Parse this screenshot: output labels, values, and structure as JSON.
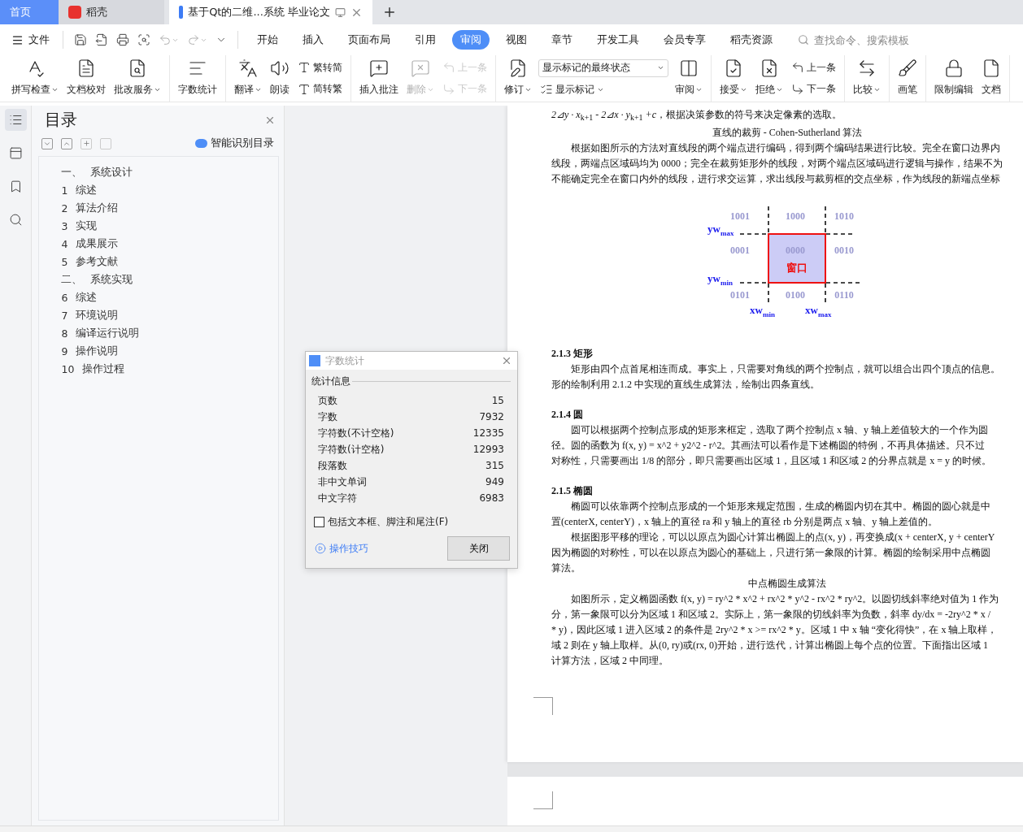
{
  "app_tabs": [
    {
      "kind": "home",
      "label": "首页",
      "selected": false
    },
    {
      "kind": "brand",
      "label": "稻壳",
      "selected": false
    },
    {
      "kind": "document",
      "label": "基于Qt的二维...系统 毕业论文",
      "selected": true
    }
  ],
  "menu": {
    "file_label": "文件",
    "tabs": [
      {
        "label": "开始",
        "selected": false
      },
      {
        "label": "插入",
        "selected": false
      },
      {
        "label": "页面布局",
        "selected": false
      },
      {
        "label": "引用",
        "selected": false
      },
      {
        "label": "审阅",
        "selected": true
      },
      {
        "label": "视图",
        "selected": false
      },
      {
        "label": "章节",
        "selected": false
      },
      {
        "label": "开发工具",
        "selected": false
      },
      {
        "label": "会员专享",
        "selected": false
      },
      {
        "label": "稻壳资源",
        "selected": false
      }
    ],
    "search": {
      "placeholder": "查找命令、搜索模板"
    }
  },
  "ribbon": [
    {
      "items": [
        {
          "kind": "large",
          "label": "拼写检查",
          "dropdown": true,
          "disabled": false
        },
        {
          "kind": "large",
          "label": "文档校对",
          "dropdown": false,
          "disabled": false
        },
        {
          "kind": "large",
          "label": "批改服务",
          "dropdown": true,
          "disabled": false
        }
      ]
    },
    {
      "items": [
        {
          "kind": "large",
          "label": "字数统计",
          "dropdown": false,
          "disabled": false
        }
      ]
    },
    {
      "items": [
        {
          "kind": "large",
          "label": "翻译",
          "dropdown": true,
          "disabled": false
        },
        {
          "kind": "large",
          "label": "朗读",
          "dropdown": false,
          "disabled": false
        },
        {
          "kind": "stack",
          "items": [
            {
              "kind": "small",
              "label": "繁转简",
              "dropdown": false,
              "disabled": false
            },
            {
              "kind": "small",
              "label": "简转繁",
              "dropdown": false,
              "disabled": false
            }
          ]
        }
      ]
    },
    {
      "items": [
        {
          "kind": "large",
          "label": "插入批注",
          "dropdown": false,
          "disabled": false
        },
        {
          "kind": "large",
          "label": "删除",
          "dropdown": true,
          "disabled": true
        },
        {
          "kind": "stack",
          "items": [
            {
              "kind": "small",
              "label": "上一条",
              "dropdown": false,
              "disabled": true
            },
            {
              "kind": "small",
              "label": "下一条",
              "dropdown": false,
              "disabled": true
            }
          ]
        }
      ]
    },
    {
      "items": [
        {
          "kind": "large",
          "label": "修订",
          "dropdown": true,
          "disabled": false
        },
        {
          "kind": "stack",
          "items": [
            {
              "kind": "select",
              "label": "显示标记的最终状态",
              "dropdown": true,
              "disabled": false
            },
            {
              "kind": "small",
              "label": "显示标记",
              "dropdown": true,
              "disabled": false
            }
          ]
        },
        {
          "kind": "large",
          "label": "审阅",
          "dropdown": true,
          "disabled": false
        }
      ]
    },
    {
      "items": [
        {
          "kind": "large",
          "label": "接受",
          "dropdown": true,
          "disabled": false
        },
        {
          "kind": "large",
          "label": "拒绝",
          "dropdown": true,
          "disabled": false
        },
        {
          "kind": "stack",
          "items": [
            {
              "kind": "small",
              "label": "上一条",
              "dropdown": false,
              "disabled": false
            },
            {
              "kind": "small",
              "label": "下一条",
              "dropdown": false,
              "disabled": false
            }
          ]
        }
      ]
    },
    {
      "items": [
        {
          "kind": "large",
          "label": "比较",
          "dropdown": true,
          "disabled": false
        }
      ]
    },
    {
      "items": [
        {
          "kind": "large",
          "label": "画笔",
          "dropdown": false,
          "disabled": false
        }
      ]
    },
    {
      "items": [
        {
          "kind": "large",
          "label": "限制编辑",
          "dropdown": false,
          "disabled": false
        },
        {
          "kind": "large",
          "label": "文档",
          "dropdown": false,
          "disabled": false
        }
      ]
    }
  ],
  "toc": {
    "title": "目录",
    "smart_label": "智能识别目录",
    "items": [
      {
        "number": "一、",
        "title": "系统设计"
      },
      {
        "number": "1",
        "title": "综述"
      },
      {
        "number": "2",
        "title": "算法介绍"
      },
      {
        "number": "3",
        "title": "实现"
      },
      {
        "number": "4",
        "title": "成果展示"
      },
      {
        "number": "5",
        "title": "参考文献"
      },
      {
        "number": "二、",
        "title": "系统实现"
      },
      {
        "number": "6",
        "title": "综述"
      },
      {
        "number": "7",
        "title": "环境说明"
      },
      {
        "number": "8",
        "title": "编译运行说明"
      },
      {
        "number": "9",
        "title": "操作说明"
      },
      {
        "number": "10",
        "title": "操作过程"
      }
    ]
  },
  "word_count_dialog": {
    "title": "字数统计",
    "group_label": "统计信息",
    "rows": [
      {
        "label": "页数",
        "value": "15"
      },
      {
        "label": "字数",
        "value": "7932"
      },
      {
        "label": "字符数(不计空格)",
        "value": "12335"
      },
      {
        "label": "字符数(计空格)",
        "value": "12993"
      },
      {
        "label": "段落数",
        "value": "315"
      },
      {
        "label": "非中文单词",
        "value": "949"
      },
      {
        "label": "中文字符",
        "value": "6983"
      }
    ],
    "include_checkbox": {
      "label": "包括文本框、脚注和尾注(F)",
      "checked": false
    },
    "tips_link": "操作技巧",
    "close_button": "关闭"
  },
  "document": {
    "blocks": [
      {
        "kind": "para",
        "indent": false,
        "lines": [
          "*2⊿y · x*$_{k+1}$ *- 2⊿x · y*$_{k+1}$ *+c*，根据决策参数的符号来决定像素的选取。"
        ]
      },
      {
        "kind": "caption",
        "lines": [
          "直线的裁剪  - Cohen-Sutherland 算法"
        ]
      },
      {
        "kind": "para",
        "indent": true,
        "lines": [
          "根据如图所示的方法对直线段的两个端点进行编码，得到两个编码结果进行比较。完全在窗口边界内",
          "线段，两端点区域码均为 0000；完全在裁剪矩形外的线段，对两个端点区域码进行逻辑与操作，结果不为",
          "不能确定完全在窗口内外的线段，进行求交运算，求出线段与裁剪框的交点坐标，作为线段的新端点坐标"
        ]
      },
      {
        "kind": "diagram",
        "codes": [
          "1001",
          "1000",
          "1010",
          "0001",
          "0000",
          "0010",
          "0101",
          "0100",
          "0110"
        ],
        "window_label": "窗口",
        "y_labels": [
          {
            "base": "yw",
            "sub": "max"
          },
          {
            "base": "yw",
            "sub": "min"
          }
        ],
        "x_labels": [
          {
            "base": "xw",
            "sub": "min"
          },
          {
            "base": "xw",
            "sub": "max"
          }
        ]
      },
      {
        "kind": "heading",
        "lines": [
          "2.1.3  矩形"
        ]
      },
      {
        "kind": "para",
        "indent": true,
        "lines": [
          "矩形由四个点首尾相连而成。事实上，只需要对角线的两个控制点，就可以组合出四个顶点的信息。",
          "形的绘制利用 2.1.2 中实现的直线生成算法，绘制出四条直线。"
        ]
      },
      {
        "kind": "heading",
        "lines": [
          "2.1.4  圆"
        ]
      },
      {
        "kind": "para",
        "indent": true,
        "lines": [
          "圆可以根据两个控制点形成的矩形来框定，选取了两个控制点 x 轴、y 轴上差值较大的一个作为圆",
          "径。圆的函数为 f(x, y) = x^2 + y2^2 - r^2。其画法可以看作是下述椭圆的特例，不再具体描述。只不过",
          "对称性，只需要画出 1/8 的部分，即只需要画出区域 1，且区域 1 和区域 2 的分界点就是 x = y 的时候。"
        ]
      },
      {
        "kind": "heading",
        "lines": [
          "2.1.5  椭圆"
        ]
      },
      {
        "kind": "para",
        "indent": true,
        "lines": [
          "椭圆可以依靠两个控制点形成的一个矩形来规定范围，生成的椭圆内切在其中。椭圆的圆心就是中",
          "置(centerX, centerY)，x 轴上的直径 ra 和 y 轴上的直径 rb 分别是两点 x 轴、y 轴上差值的。"
        ]
      },
      {
        "kind": "para",
        "indent": true,
        "lines": [
          "根据图形平移的理论，可以以原点为圆心计算出椭圆上的点(x, y)，再变换成(x + centerX, y + centerY",
          "因为椭圆的对称性，可以在以原点为圆心的基础上，只进行第一象限的计算。椭圆的绘制采用中点椭圆",
          "算法。"
        ]
      },
      {
        "kind": "caption",
        "lines": [
          "中点椭圆生成算法"
        ]
      },
      {
        "kind": "para",
        "indent": true,
        "lines": [
          "如图所示，定义椭圆函数 f(x, y) = ry^2 * x^2 + rx^2 * y^2 - rx^2 * ry^2。以圆切线斜率绝对值为 1 作为",
          "分，第一象限可以分为区域 1 和区域 2。实际上，第一象限的切线斜率为负数，斜率 dy/dx = -2ry^2 * x /",
          "* y)，因此区域 1 进入区域 2 的条件是 2ry^2 * x >= rx^2 * y。区域 1 中 x 轴 “变化得快”，在 x 轴上取样，",
          "域 2 则在 y 轴上取样。从(0, ry)或(rx, 0)开始，进行迭代，计算出椭圆上每个点的位置。下面指出区域 1",
          "计算方法，区域 2 中同理。"
        ]
      }
    ]
  }
}
